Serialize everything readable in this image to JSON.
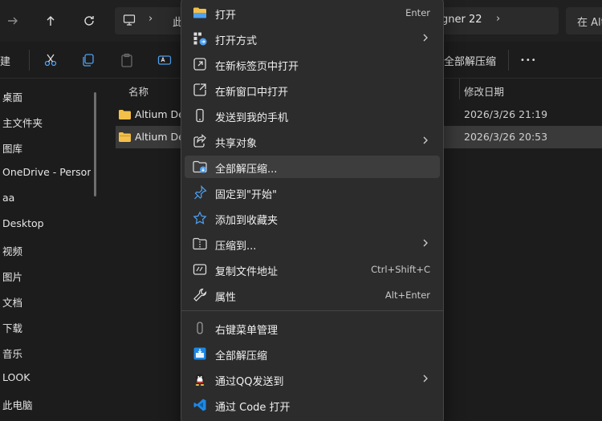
{
  "address_bar": {
    "path_segment_1": "此",
    "path_segment_2": "gner 22",
    "search_placeholder": "在 Alt"
  },
  "toolbar": {
    "new_label": "建",
    "extract_all_label": "全部解压缩",
    "more_label": "•••"
  },
  "sidebar": {
    "items": [
      {
        "label": "桌面"
      },
      {
        "label": "主文件夹"
      },
      {
        "label": "图库"
      },
      {
        "label": "OneDrive - Person"
      },
      {
        "label": "aa"
      },
      {
        "label": "Desktop"
      },
      {
        "label": "视频"
      },
      {
        "label": "图片"
      },
      {
        "label": "文档"
      },
      {
        "label": "下载"
      },
      {
        "label": "音乐"
      },
      {
        "label": "LOOK"
      },
      {
        "label": "此电脑"
      }
    ]
  },
  "filelist": {
    "columns": {
      "name": "名称",
      "modified": "修改日期"
    },
    "rows": [
      {
        "name": "Altium De",
        "modified": "2026/3/26 21:19",
        "selected": false
      },
      {
        "name": "Altium De",
        "modified": "2026/3/26 20:53",
        "selected": true
      }
    ]
  },
  "context_menu": {
    "items": [
      {
        "label": "打开",
        "shortcut": "Enter",
        "icon": "folder-open-icon"
      },
      {
        "label": "打开方式",
        "shortcut": "",
        "icon": "open-with-icon",
        "submenu": true
      },
      {
        "label": "在新标签页中打开",
        "shortcut": "",
        "icon": "new-tab-icon"
      },
      {
        "label": "在新窗口中打开",
        "shortcut": "",
        "icon": "new-window-icon"
      },
      {
        "label": "发送到我的手机",
        "shortcut": "",
        "icon": "phone-icon"
      },
      {
        "label": "共享对象",
        "shortcut": "",
        "icon": "share-icon",
        "submenu": true
      },
      {
        "label": "全部解压缩...",
        "shortcut": "",
        "icon": "extract-icon",
        "hover": true
      },
      {
        "label": "固定到\"开始\"",
        "shortcut": "",
        "icon": "pin-icon"
      },
      {
        "label": "添加到收藏夹",
        "shortcut": "",
        "icon": "star-icon"
      },
      {
        "label": "压缩到...",
        "shortcut": "",
        "icon": "zip-icon",
        "submenu": true
      },
      {
        "label": "复制文件地址",
        "shortcut": "Ctrl+Shift+C",
        "icon": "copy-path-icon"
      },
      {
        "label": "属性",
        "shortcut": "Alt+Enter",
        "icon": "wrench-icon"
      },
      {
        "label": "右键菜单管理",
        "shortcut": "",
        "icon": "menu-manager-icon"
      },
      {
        "label": "全部解压缩",
        "shortcut": "",
        "icon": "extract-app-icon"
      },
      {
        "label": "通过QQ发送到",
        "shortcut": "",
        "icon": "qq-icon",
        "submenu": true
      },
      {
        "label": "通过 Code 打开",
        "shortcut": "",
        "icon": "vscode-icon"
      }
    ]
  },
  "colors": {
    "accent_blue": "#4ea1f3",
    "folder_yellow": "#f3c04a",
    "menu_bg": "#2c2c2c"
  }
}
